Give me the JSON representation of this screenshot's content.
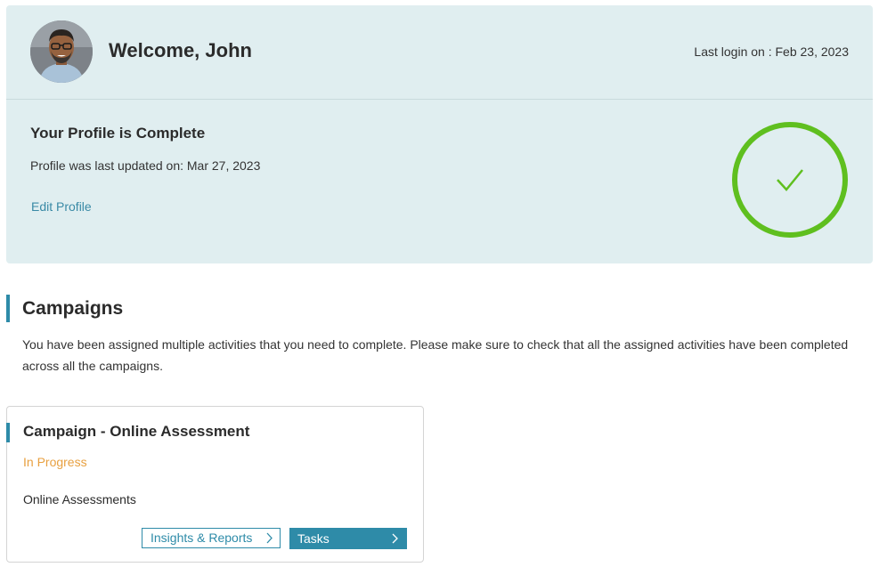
{
  "header": {
    "welcome": "Welcome, John",
    "last_login": "Last login on : Feb 23, 2023"
  },
  "profile": {
    "title": "Your Profile is Complete",
    "updated": "Profile was last updated on: Mar 27, 2023",
    "edit_link": "Edit Profile",
    "status_icon": "check-circle-icon",
    "status_color": "#5fbf1f"
  },
  "campaigns": {
    "title": "Campaigns",
    "description": "You have been assigned multiple activities that you need to complete. Please make sure to check that all the assigned activities have been completed across all the campaigns.",
    "items": [
      {
        "title": "Campaign - Online Assessment",
        "status": "In Progress",
        "type": "Online Assessments",
        "insights_label": "Insights & Reports",
        "tasks_label": "Tasks"
      }
    ]
  },
  "colors": {
    "accent": "#2e8ba8",
    "header_bg": "#e0eef0",
    "status_in_progress": "#e8a040"
  }
}
